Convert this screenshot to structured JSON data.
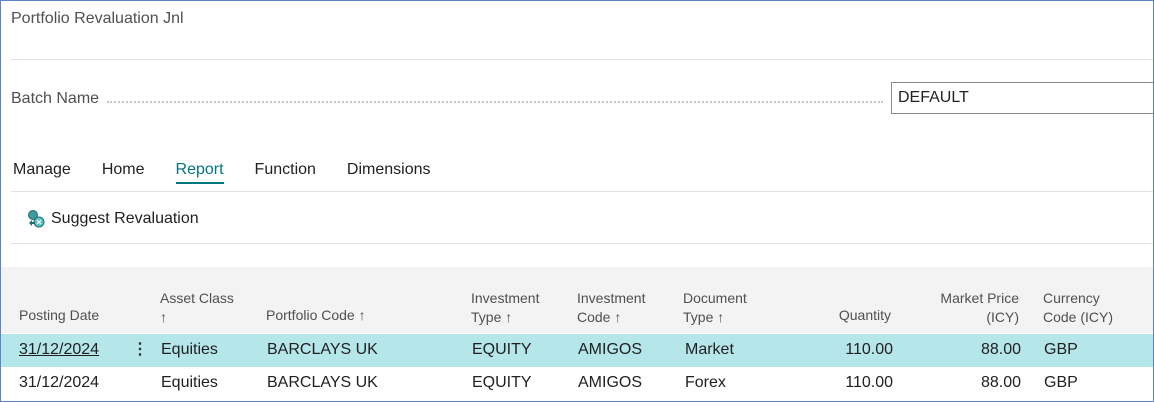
{
  "page": {
    "title": "Portfolio Revaluation Jnl"
  },
  "batch": {
    "label": "Batch Name",
    "value": "DEFAULT"
  },
  "tabs": [
    {
      "label": "Manage"
    },
    {
      "label": "Home"
    },
    {
      "label": "Report"
    },
    {
      "label": "Function"
    },
    {
      "label": "Dimensions"
    }
  ],
  "action": {
    "label": "Suggest Revaluation",
    "icon": "suggest-revaluation-icon"
  },
  "columns": {
    "posting_date": "Posting Date",
    "asset_class": "Asset Class",
    "portfolio_code": "Portfolio Code",
    "investment_type_1": "Investment",
    "investment_type_2": "Type",
    "investment_code_1": "Investment",
    "investment_code_2": "Code",
    "document_type_1": "Document",
    "document_type_2": "Type",
    "quantity": "Quantity",
    "market_price_1": "Market Price",
    "market_price_2": "(ICY)",
    "currency_code_1": "Currency",
    "currency_code_2": "Code (ICY)",
    "sort_arrow": "↑"
  },
  "rows": [
    {
      "posting_date": "31/12/2024",
      "menu": "⋮",
      "asset_class": "Equities",
      "portfolio_code": "BARCLAYS UK",
      "investment_type": "EQUITY",
      "investment_code": "AMIGOS",
      "document_type": "Market",
      "quantity": "110.00",
      "market_price": "88.00",
      "currency_code": "GBP"
    },
    {
      "posting_date": "31/12/2024",
      "asset_class": "Equities",
      "portfolio_code": "BARCLAYS UK",
      "investment_type": "EQUITY",
      "investment_code": "AMIGOS",
      "document_type": "Forex",
      "quantity": "110.00",
      "market_price": "88.00",
      "currency_code": "GBP"
    }
  ],
  "colors": {
    "accent": "#00767e",
    "selected_row": "#b4e6ea",
    "header_bg": "#f3f3f3",
    "frame": "#5b86c6"
  }
}
